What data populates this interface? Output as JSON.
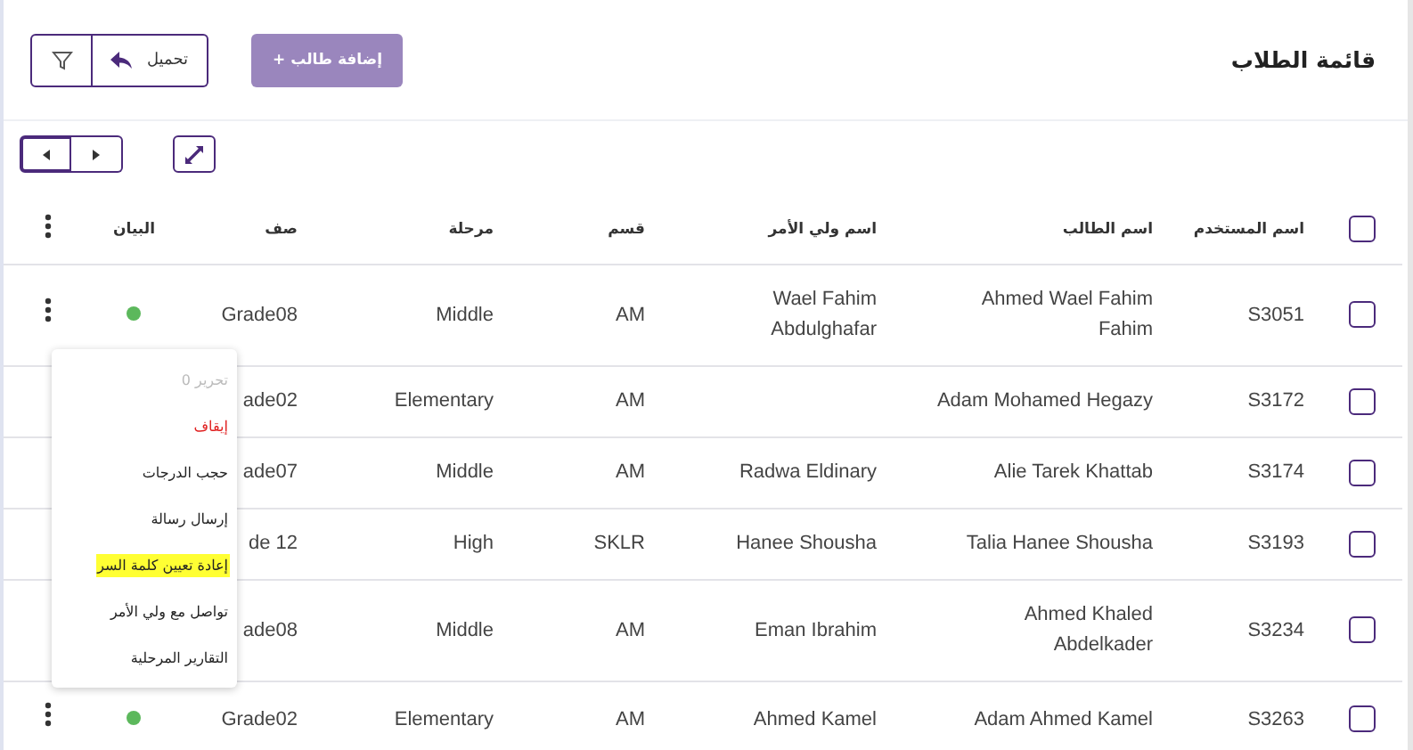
{
  "title": "قائمة الطلاب",
  "add_button": "+ إضافة طالب",
  "download_button": "تحميل",
  "columns": [
    "اسم المستخدم",
    "اسم الطالب",
    "اسم ولي الأمر",
    "قسم",
    "مرحلة",
    "صف",
    "البيان"
  ],
  "header_checkbox": {
    "checked": false
  },
  "rows": [
    {
      "username": "S3051",
      "student": "Ahmed Wael Fahim Fahim",
      "guardian": "Wael Fahim Abdulghafar",
      "section": "AM",
      "stage": "Middle",
      "grade": "Grade08",
      "checked": false,
      "color": "#5cb85c"
    },
    {
      "username": "S3172",
      "student": "Adam Mohamed Hegazy",
      "section": "AM",
      "stage": "Elementary",
      "grade": "ade02",
      "checked": false
    },
    {
      "username": "S3174",
      "student": "Alie Tarek Khattab",
      "guardian": "Radwa Eldinary",
      "section": "AM",
      "stage": "Middle",
      "grade": "ade07",
      "checked": false
    },
    {
      "username": "S3193",
      "student": "Talia Hanee Shousha",
      "guardian": "Hanee Shousha",
      "section": "SKLR",
      "stage": "High",
      "grade": "de 12",
      "checked": false
    },
    {
      "username": "S3234",
      "student": "Ahmed Khaled Abdelkader",
      "guardian": "Eman Ibrahim",
      "section": "AM",
      "stage": "Middle",
      "grade": "ade08",
      "checked": false
    },
    {
      "username": "S3263",
      "student": "Adam Ahmed Kamel",
      "guardian": "Ahmed Kamel",
      "section": "AM",
      "stage": "Elementary",
      "grade": "Grade02",
      "checked": false,
      "color": "#5cb85c"
    }
  ],
  "menu": [
    {
      "label": "تحرير 0",
      "kind": "disabled",
      "highlighted": false
    },
    {
      "label": "إيقاف",
      "kind": "danger",
      "highlighted": false
    },
    {
      "label": "حجب الدرجات",
      "kind": "normal",
      "highlighted": false
    },
    {
      "label": "إرسال رسالة",
      "kind": "normal",
      "highlighted": false
    },
    {
      "label": "إعادة تعيين كلمة السر",
      "kind": "normal",
      "highlighted": true
    },
    {
      "label": "تواصل مع ولي الأمر",
      "kind": "normal",
      "highlighted": false
    },
    {
      "label": "التقارير المرحلية",
      "kind": "normal",
      "highlighted": false
    }
  ]
}
